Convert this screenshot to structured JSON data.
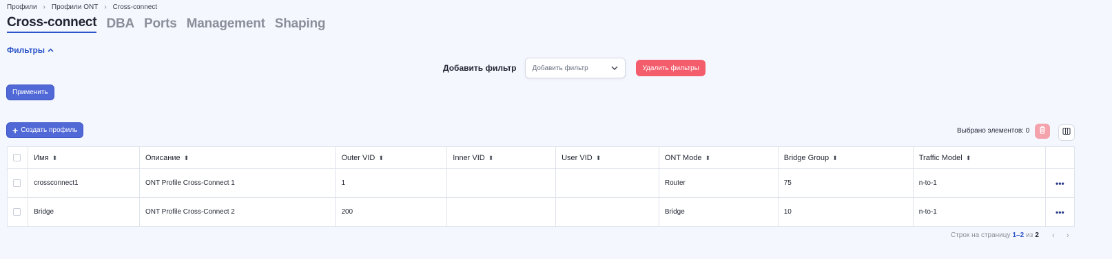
{
  "breadcrumb": {
    "items": [
      "Профили",
      "Профили ONT",
      "Cross-connect"
    ],
    "separator": ">"
  },
  "tabs": [
    {
      "label": "Cross-connect",
      "active": true
    },
    {
      "label": "DBA",
      "active": false
    },
    {
      "label": "Ports",
      "active": false
    },
    {
      "label": "Management",
      "active": false
    },
    {
      "label": "Shaping",
      "active": false
    }
  ],
  "filters": {
    "toggle_label": "Фильтры",
    "add_filter_label": "Добавить фильтр",
    "select_value": "Добавить фильтр",
    "delete_filters_label": "Удалить фильтры",
    "apply_label": "Применить"
  },
  "toolbar": {
    "create_profile_label": "Создать профиль",
    "selected_text": "Выбрано элементов: 0"
  },
  "table": {
    "columns": [
      "Имя",
      "Описание",
      "Outer VID",
      "Inner VID",
      "User VID",
      "ONT Mode",
      "Bridge Group",
      "Traffic Model"
    ],
    "rows": [
      {
        "name": "crossconnect1",
        "description": "ONT Profile Cross-Connect 1",
        "outer_vid": "1",
        "inner_vid": "",
        "user_vid": "",
        "ont_mode": "Router",
        "bridge_group": "75",
        "traffic_model": "n-to-1"
      },
      {
        "name": "Bridge",
        "description": "ONT Profile Cross-Connect 2",
        "outer_vid": "200",
        "inner_vid": "",
        "user_vid": "",
        "ont_mode": "Bridge",
        "bridge_group": "10",
        "traffic_model": "n-to-1"
      }
    ],
    "row_menu": "•••"
  },
  "pagination": {
    "label": "Строк на страницу",
    "range": "1–2",
    "of": "из",
    "total": "2"
  },
  "colors": {
    "accent": "#2d55c9",
    "primary_button": "#5169d6",
    "danger": "#f35d6c",
    "background": "#f4f7fe"
  },
  "icons": {
    "breadcrumb_separator": "chevron-right-icon",
    "filters_toggle": "chevron-up-icon",
    "select": "chevron-down-icon",
    "create": "plus-icon",
    "delete_selected": "trash-icon",
    "columns": "columns-icon",
    "sort": "sort-icon",
    "row_menu": "more-horizontal-icon",
    "pager_prev": "chevron-left-icon",
    "pager_next": "chevron-right-icon"
  }
}
